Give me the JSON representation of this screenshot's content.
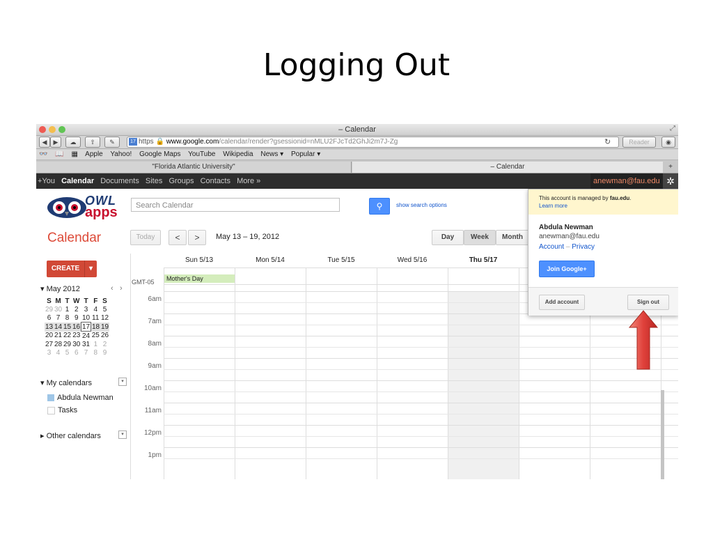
{
  "slide": {
    "title": "Logging Out"
  },
  "browser": {
    "window_title": "– Calendar",
    "url_scheme": "https",
    "url_host": "www.google.com",
    "url_path": "/calendar/render?gsessionid=nMLU2FJcTd2GhJi2m7J-Zg",
    "reader_label": "Reader",
    "bookmarks": [
      "Apple",
      "Yahoo!",
      "Google Maps",
      "YouTube",
      "Wikipedia",
      "News ▾",
      "Popular ▾"
    ],
    "tabs": [
      {
        "label": "\"Florida Atlantic University\""
      },
      {
        "label": "– Calendar"
      }
    ],
    "new_tab_label": "+"
  },
  "google_bar": {
    "items": [
      "+You",
      "Calendar",
      "Documents",
      "Sites",
      "Groups",
      "Contacts",
      "More »"
    ],
    "account_email": "anewman@fau.edu",
    "account_caret": "▾"
  },
  "header": {
    "logo_text_top": "OWL",
    "logo_text_bottom": "apps",
    "search_placeholder": "Search Calendar",
    "search_options_label": "show search options"
  },
  "toolbar": {
    "calendar_title": "Calendar",
    "today_label": "Today",
    "prev_label": "<",
    "next_label": ">",
    "date_range": "May 13 – 19, 2012",
    "views": [
      "Day",
      "Week",
      "Month"
    ],
    "active_view": "Week"
  },
  "sidebar": {
    "create_label": "CREATE",
    "create_dropdown": "▾",
    "mini_month": "May 2012",
    "mini_nav_prev": "‹",
    "mini_nav_next": "›",
    "weekday_headers": [
      "S",
      "M",
      "T",
      "W",
      "T",
      "F",
      "S"
    ],
    "weeks": [
      [
        "29",
        "30",
        "1",
        "2",
        "3",
        "4",
        "5"
      ],
      [
        "6",
        "7",
        "8",
        "9",
        "10",
        "11",
        "12"
      ],
      [
        "13",
        "14",
        "15",
        "16",
        "17",
        "18",
        "19"
      ],
      [
        "20",
        "21",
        "22",
        "23",
        "24",
        "25",
        "26"
      ],
      [
        "27",
        "28",
        "29",
        "30",
        "31",
        "1",
        "2"
      ],
      [
        "3",
        "4",
        "5",
        "6",
        "7",
        "8",
        "9"
      ]
    ],
    "today_day": "17",
    "my_calendars_label": "My calendars",
    "my_calendars": [
      {
        "name": "Abdula Newman",
        "color": "#9fc6e7"
      },
      {
        "name": "Tasks",
        "color": "#ffffff"
      }
    ],
    "other_calendars_label": "Other calendars"
  },
  "grid": {
    "timezone": "GMT-05",
    "days": [
      "Sun 5/13",
      "Mon 5/14",
      "Tue 5/15",
      "Wed 5/16",
      "Thu 5/17"
    ],
    "today_index": 4,
    "all_day_event": {
      "title": "Mother's Day",
      "day_index": 0,
      "color": "#d4edbc"
    },
    "hours": [
      "6am",
      "7am",
      "8am",
      "9am",
      "10am",
      "11am",
      "12pm",
      "1pm"
    ]
  },
  "account_popup": {
    "managed_notice_prefix": "This account is managed by ",
    "managed_domain": "fau.edu",
    "managed_notice_suffix": ".",
    "learn_more": "Learn more",
    "name": "Abdula Newman",
    "email": "anewman@fau.edu",
    "account_link": "Account",
    "separator": "–",
    "privacy_link": "Privacy",
    "join_label": "Join Google+",
    "add_account_label": "Add account",
    "sign_out_label": "Sign out"
  },
  "colors": {
    "accent_red": "#dd4b39",
    "google_blue": "#4d90fe",
    "arrow_red": "#e0413b"
  }
}
